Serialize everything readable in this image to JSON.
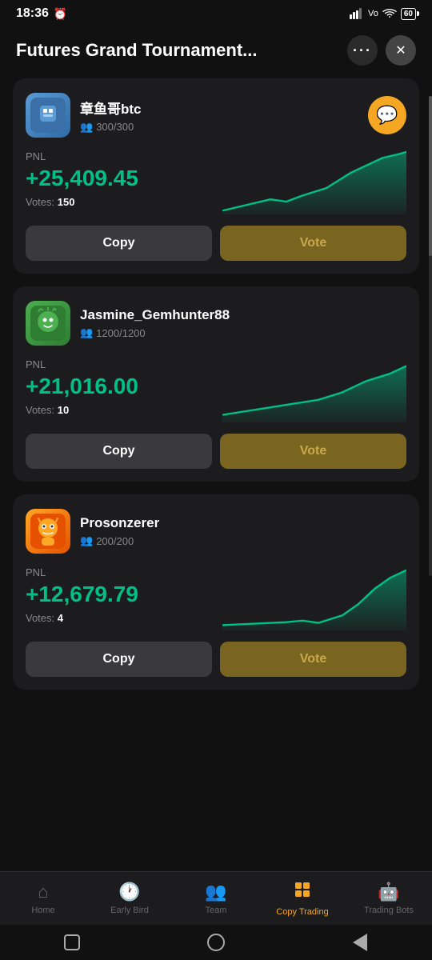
{
  "statusBar": {
    "time": "18:36",
    "alarmIcon": "⏰",
    "signalText": "Vo",
    "wifiLabel": "WiFi",
    "batteryLevel": "60"
  },
  "header": {
    "title": "Futures Grand Tournament...",
    "moreLabel": "•••",
    "closeLabel": "✕"
  },
  "traders": [
    {
      "id": 1,
      "name": "章鱼哥btc",
      "followers": "300/300",
      "pnlLabel": "PNL",
      "pnlValue": "+25,409.45",
      "votesLabel": "Votes:",
      "votesCount": "150",
      "avatarEmoji": "🐙",
      "avatarClass": "avatar-1",
      "hasChatBtn": true,
      "copyLabel": "Copy",
      "voteLabel": "Vote",
      "chartPoints": "0,80 20,75 40,70 60,65 80,68 100,60 130,50 160,30 180,20 200,10 220,5 230,2"
    },
    {
      "id": 2,
      "name": "Jasmine_Gemhunter88",
      "followers": "1200/1200",
      "pnlLabel": "PNL",
      "pnlValue": "+21,016.00",
      "votesLabel": "Votes:",
      "votesCount": "10",
      "avatarEmoji": "🌿",
      "avatarClass": "avatar-2",
      "hasChatBtn": false,
      "copyLabel": "Copy",
      "voteLabel": "Vote",
      "chartPoints": "0,75 30,70 60,65 90,60 120,55 150,45 180,30 210,20 230,10"
    },
    {
      "id": 3,
      "name": "Prosonzerer",
      "followers": "200/200",
      "pnlLabel": "PNL",
      "pnlValue": "+12,679.79",
      "votesLabel": "Votes:",
      "votesCount": "4",
      "avatarEmoji": "🤖",
      "avatarClass": "avatar-3",
      "hasChatBtn": false,
      "copyLabel": "Copy",
      "voteLabel": "Vote",
      "chartPoints": "0,78 40,76 80,74 100,72 120,75 150,65 170,50 190,30 210,15 230,5"
    }
  ],
  "bottomNav": {
    "items": [
      {
        "id": "home",
        "label": "Home",
        "icon": "⌂",
        "active": false
      },
      {
        "id": "earlybird",
        "label": "Early Bird",
        "icon": "🕐",
        "active": false
      },
      {
        "id": "team",
        "label": "Team",
        "icon": "👥",
        "active": false
      },
      {
        "id": "copytrading",
        "label": "Copy Trading",
        "icon": "📋",
        "active": true
      },
      {
        "id": "tradingbots",
        "label": "Trading Bots",
        "icon": "🤖",
        "active": false
      }
    ]
  }
}
